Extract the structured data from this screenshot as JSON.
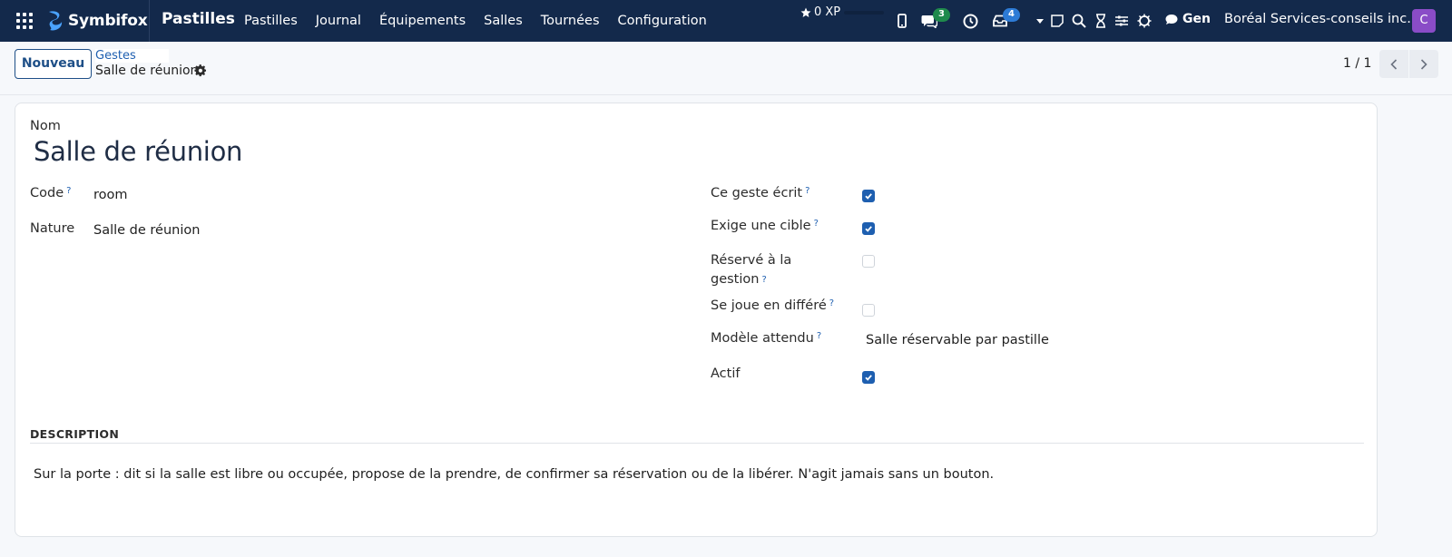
{
  "navbar": {
    "brand": "Symbifox",
    "app_title": "Pastilles",
    "menu": [
      "Pastilles",
      "Journal",
      "Équipements",
      "Salles",
      "Tournées",
      "Configuration"
    ],
    "xp": "0 XP",
    "messages_count": "3",
    "activities_count": "4",
    "gen_label": "Gen",
    "company": "Boréal Services-conseils inc.",
    "avatar_initial": "C",
    "icons": [
      "apps-icon",
      "star-icon",
      "phone-icon",
      "chat-icon",
      "clock-icon",
      "inbox-icon",
      "caret-down-icon",
      "note-icon",
      "search-icon",
      "hourglass-icon",
      "sliders-icon",
      "bug-icon",
      "chat-bubble-icon"
    ]
  },
  "control": {
    "new_button": "Nouveau",
    "breadcrumb_parent": "Gestes",
    "breadcrumb_current": "Salle de réunion",
    "pager": "1 / 1"
  },
  "form": {
    "name_label": "Nom",
    "name_value": "Salle de réunion",
    "code_label": "Code",
    "code_value": "room",
    "nature_label": "Nature",
    "nature_value": "Salle de réunion",
    "right_fields": [
      {
        "label": "Ce geste écrit",
        "help": "?",
        "checked": true
      },
      {
        "label": "Exige une cible",
        "help": "?",
        "checked": true
      },
      {
        "label": "Réservé à la",
        "label2": "gestion",
        "help": "?",
        "checked": false
      },
      {
        "label": "Se joue en différé",
        "help": "?",
        "checked": false
      }
    ],
    "model_label": "Modèle attendu",
    "model_value": "Salle réservable par pastille",
    "active_label": "Actif",
    "active_checked": true,
    "help_mark": "?",
    "description_title": "DESCRIPTION",
    "description_text": "Sur la porte : dit si la salle est libre ou occupée, propose de la prendre, de confirmer sa réservation ou de la libérer. N'agit jamais sans un bouton."
  },
  "colors": {
    "navbar": "#13294b",
    "accent": "#1e5fb0",
    "badge_green": "#1f8a4c",
    "badge_blue": "#2d7bd6",
    "avatar": "#8a4cc7"
  }
}
